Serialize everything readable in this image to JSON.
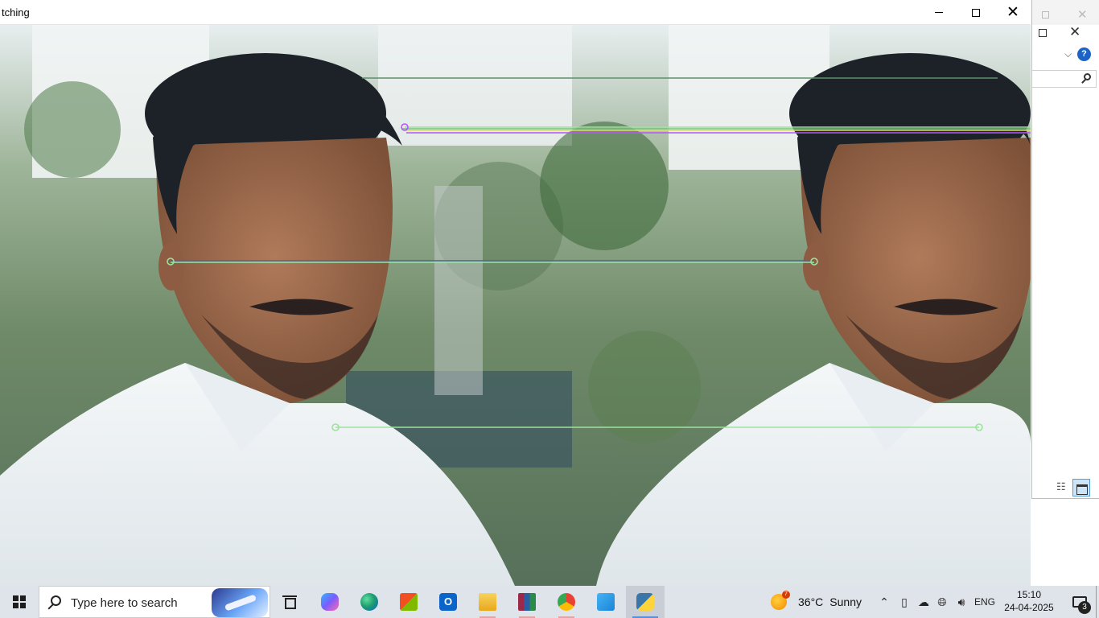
{
  "window": {
    "title": "tching",
    "minimize_label": "minimize",
    "maximize_label": "maximize",
    "close_glyph": "✕"
  },
  "image_view": {
    "content": "side-by-side duplicate portrait photo with feature-match lines",
    "match_line_colors": [
      "#5d8f6b",
      "#9be39b",
      "#b455ff",
      "#e0e060",
      "#7fbf7f",
      "#4a4aaa"
    ]
  },
  "background_window": {
    "close_glyph": "✕",
    "help_glyph": "?",
    "chevron_glyph": "⌵"
  },
  "taskbar": {
    "search_placeholder": "Type here to search",
    "apps": [
      {
        "name": "task-view",
        "icon": "task-view-icon"
      },
      {
        "name": "copilot",
        "icon": "copilot-icon",
        "color": "#7a5cff"
      },
      {
        "name": "edge",
        "icon": "edge-icon",
        "color": "#1f9e6f"
      },
      {
        "name": "microsoft-store",
        "icon": "store-icon",
        "color": "#1e6fd9"
      },
      {
        "name": "outlook",
        "icon": "outlook-icon",
        "color": "#0a64c9"
      },
      {
        "name": "file-explorer",
        "icon": "folder-icon",
        "color": "#f2b72a"
      },
      {
        "name": "winrar",
        "icon": "winrar-icon",
        "color": "#9b2a4a"
      },
      {
        "name": "chrome",
        "icon": "chrome-icon",
        "color": "#e94235"
      },
      {
        "name": "photos",
        "icon": "photos-icon",
        "color": "#1b83d6"
      },
      {
        "name": "python",
        "icon": "python-icon",
        "color": "#3a76a8"
      }
    ],
    "weather": {
      "temp": "36°C",
      "condition": "Sunny",
      "badge": "7"
    },
    "lang": "ENG",
    "time": "15:10",
    "date": "24-04-2025",
    "notifications": "3"
  }
}
